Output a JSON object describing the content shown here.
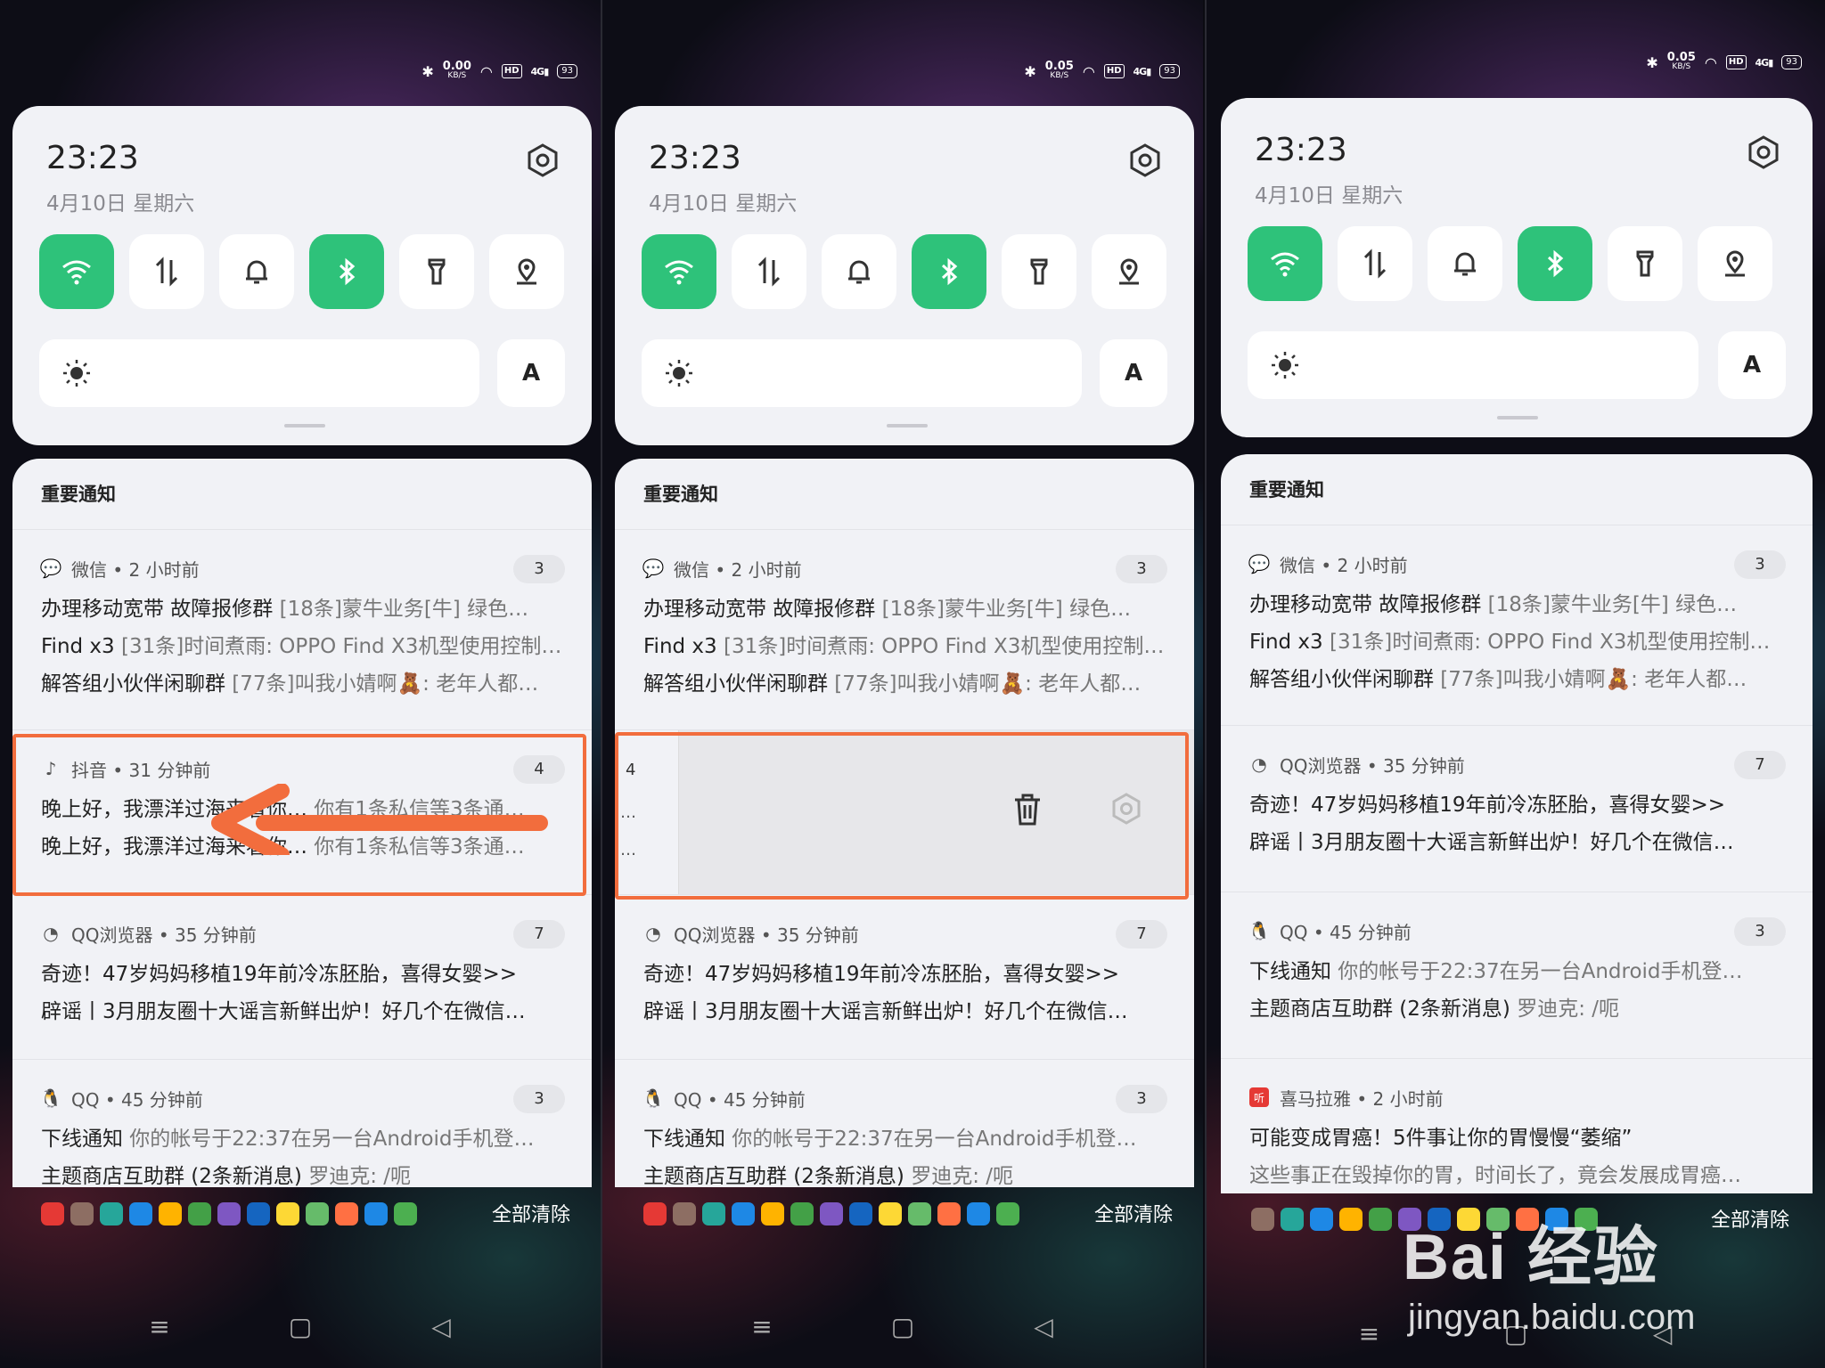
{
  "status": {
    "bt": "✱",
    "panel1_speed": "0.00",
    "panel2_speed": "0.05",
    "panel3_speed": "0.05",
    "unit": "KB/S",
    "hd": "HD",
    "signal": "4G",
    "battery": "93"
  },
  "clock": {
    "time": "23:23",
    "date": "4月10日  星期六"
  },
  "auto_label": "A",
  "section_title": "重要通知",
  "clear_all": "全部清除",
  "wechat": {
    "app": "微信 • 2 小时前",
    "count": "3",
    "rows": [
      {
        "title": "办理移动宽带  故障报修群",
        "body": " [18条]蒙牛业务[牛] 绿色…"
      },
      {
        "title": "Find x3",
        "body": " [31条]时间煮雨: OPPO Find X3机型使用控制…"
      },
      {
        "title": "解答组小伙伴闲聊群",
        "body": " [77条]叫我小婧啊🧸: 老年人都…"
      }
    ]
  },
  "douyin": {
    "app": "抖音 • 31 分钟前",
    "count": "4",
    "rows": [
      {
        "title": "晚上好，我漂洋过海来看你…",
        "body": " 你有1条私信等3条通…"
      },
      {
        "title": "晚上好，我漂洋过海来看你…",
        "body": " 你有1条私信等3条通…"
      }
    ],
    "swiped_count": "4",
    "swiped_dot": "…"
  },
  "qqbrowser": {
    "app": "QQ浏览器 • 35 分钟前",
    "count": "7",
    "rows": [
      {
        "title": "奇迹！47岁妈妈移植19年前冷冻胚胎，喜得女婴>>",
        "body": ""
      },
      {
        "title": "辟谣丨3月朋友圈十大谣言新鲜出炉！好几个在微信…",
        "body": ""
      }
    ]
  },
  "qq": {
    "app": "QQ • 45 分钟前",
    "count": "3",
    "rows": [
      {
        "title": "下线通知",
        "body": " 你的帐号于22:37在另一台Android手机登…"
      },
      {
        "title": "主题商店互助群 (2条新消息)",
        "body": " 罗迪克: /呃"
      }
    ]
  },
  "ximalaya": {
    "app": "喜马拉雅 • 2 小时前",
    "rows": [
      {
        "title": "可能变成胃癌！5件事让你的胃慢慢“萎缩”",
        "body": ""
      },
      {
        "title": "",
        "body": "这些事正在毁掉你的胃，时间长了，竟会发展成胃癌…"
      }
    ]
  },
  "watermark": {
    "brand": "Bai 经验",
    "url": "jingyan.baidu.com"
  },
  "colors": {
    "accent": "#2ec27a",
    "highlight": "#f26d3d",
    "panel": "#f1f2f6"
  },
  "icons": [
    "wifi-icon",
    "data-icon",
    "bell-icon",
    "bluetooth-icon",
    "flashlight-icon",
    "location-icon",
    "gear-icon",
    "sun-icon",
    "trash-icon"
  ]
}
